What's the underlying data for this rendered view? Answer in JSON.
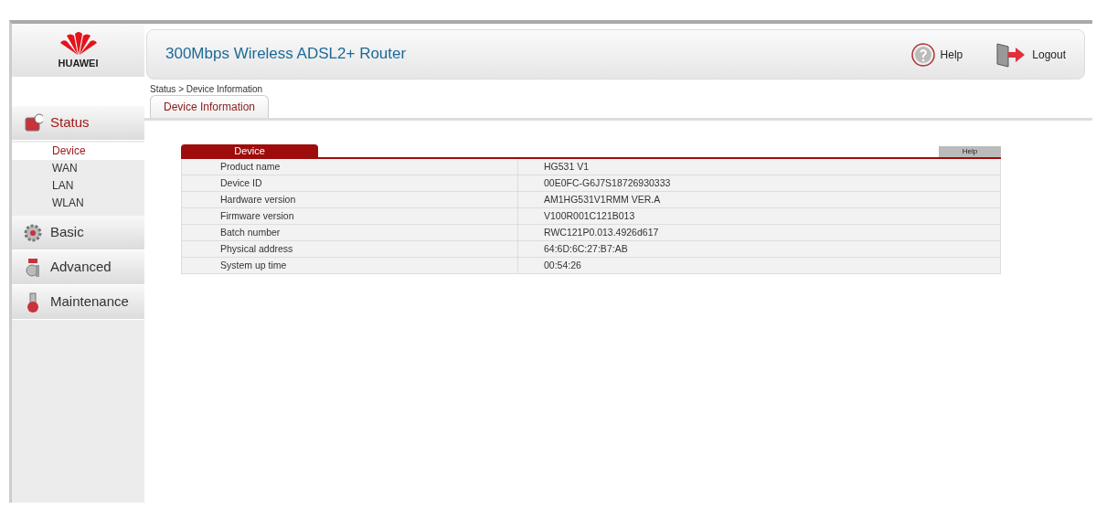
{
  "logo": {
    "text": "HUAWEI"
  },
  "header": {
    "title": "300Mbps Wireless ADSL2+ Router",
    "links": [
      {
        "label": "Help",
        "kind": "help"
      },
      {
        "label": "Logout",
        "kind": "logout"
      }
    ]
  },
  "breadcrumb": "Status > Device Information",
  "tabs": [
    {
      "label": "Device Information",
      "selected": true
    }
  ],
  "sidebar": {
    "items": [
      {
        "label": "Status",
        "kind": "status",
        "selected": true,
        "children": [
          {
            "label": "Device",
            "selected": true
          },
          {
            "label": "WAN",
            "selected": false
          },
          {
            "label": "LAN",
            "selected": false
          },
          {
            "label": "WLAN",
            "selected": false
          }
        ]
      },
      {
        "label": "Basic",
        "kind": "basic",
        "selected": false
      },
      {
        "label": "Advanced",
        "kind": "advanced",
        "selected": false
      },
      {
        "label": "Maintenance",
        "kind": "maintenance",
        "selected": false
      }
    ]
  },
  "panel": {
    "title": "Device",
    "help": "Help",
    "rows": [
      {
        "label": "Product name",
        "value": "HG531 V1"
      },
      {
        "label": "Device ID",
        "value": "00E0FC-G6J7S18726930333"
      },
      {
        "label": "Hardware version",
        "value": "AM1HG531V1RMM VER.A"
      },
      {
        "label": "Firmware version",
        "value": "V100R001C121B013"
      },
      {
        "label": "Batch number",
        "value": "RWC121P0.013.4926d617"
      },
      {
        "label": "Physical address",
        "value": "64:6D:6C:27:B7:AB"
      },
      {
        "label": "System up time",
        "value": "00:54:26"
      }
    ]
  }
}
